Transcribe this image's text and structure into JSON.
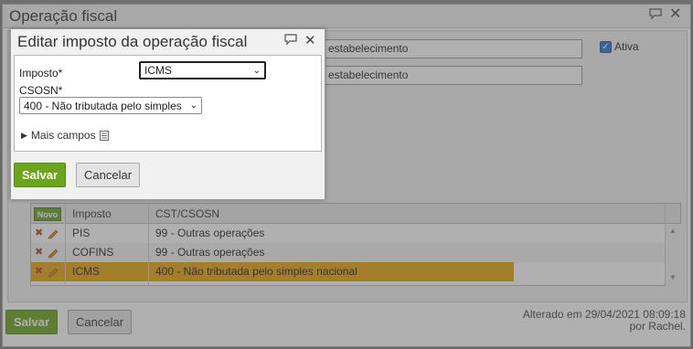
{
  "main": {
    "title": "Operação fiscal",
    "field1_value": "estabelecimento",
    "field2_value": "estabelecimento",
    "ativa_label": "Ativa",
    "ativa_checked": true,
    "save_label": "Salvar",
    "cancel_label": "Cancelar",
    "footer_line1": "Alterado em 29/04/2021 08:09:18",
    "footer_line2": "por Rachel."
  },
  "grid": {
    "novo_label": "Novo",
    "columns": [
      "Imposto",
      "CST/CSOSN"
    ],
    "rows": [
      {
        "imposto": "PIS",
        "cst": "99 - Outras operações",
        "selected": false
      },
      {
        "imposto": "COFINS",
        "cst": "99 - Outras operações",
        "selected": false
      },
      {
        "imposto": "ICMS",
        "cst": "400 - Não tributada pelo simples nacional",
        "selected": true
      }
    ]
  },
  "dialog": {
    "title": "Editar imposto da operação fiscal",
    "imposto_label": "Imposto*",
    "imposto_value": "ICMS",
    "csosn_label": "CSOSN*",
    "csosn_value": "400 - Não tributada pelo simples",
    "more_fields_label": "Mais campos",
    "save_label": "Salvar",
    "cancel_label": "Cancelar"
  },
  "colors": {
    "accent_green": "#6aa51c",
    "selected_row": "#e8a511"
  }
}
